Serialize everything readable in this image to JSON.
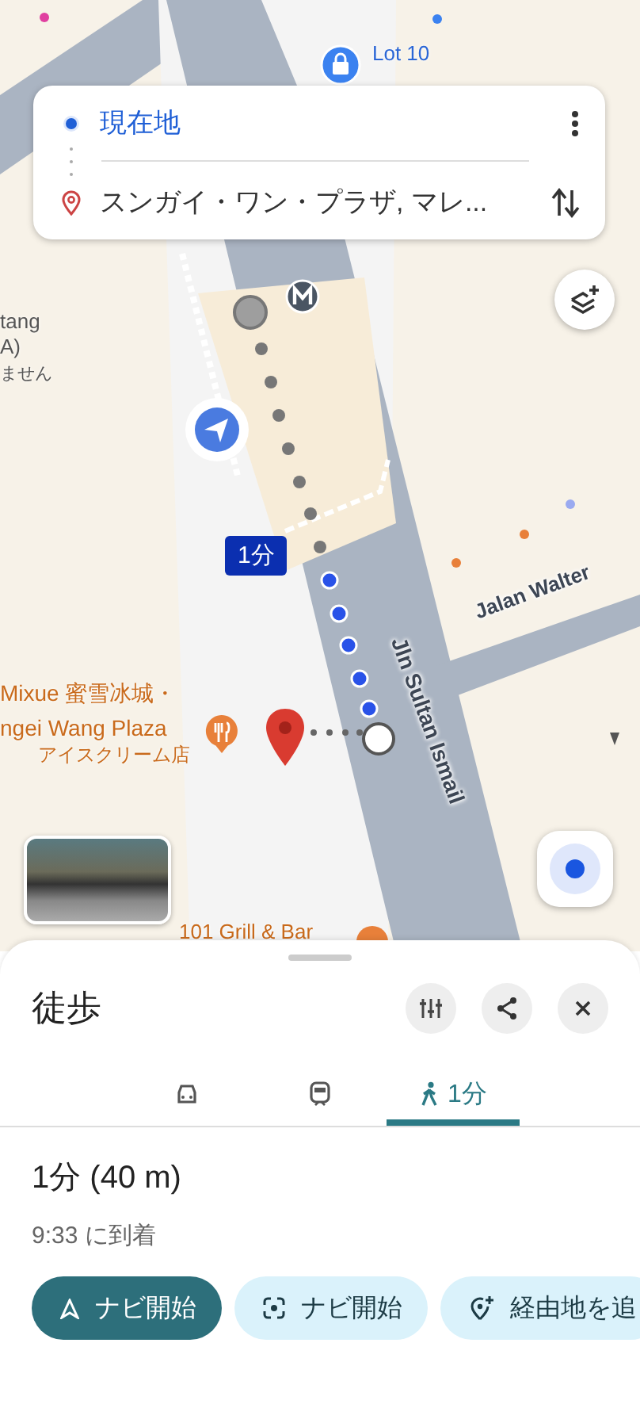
{
  "directions_card": {
    "origin": "現在地",
    "destination": "スンガイ・ワン・プラザ, マレ..."
  },
  "map": {
    "route_badge": "1分",
    "labels": [
      {
        "kind": "poi",
        "text": "Lot 10"
      },
      {
        "kind": "place",
        "text": "tang"
      },
      {
        "kind": "place",
        "text": "A)"
      },
      {
        "kind": "place",
        "text": "ません"
      },
      {
        "kind": "road",
        "text": "Jalan Walter"
      },
      {
        "kind": "road",
        "text": "Jln Sultan Ismail"
      },
      {
        "kind": "food",
        "text": "Mixue 蜜雪冰城・"
      },
      {
        "kind": "food",
        "text": "ngei Wang Plaza"
      },
      {
        "kind": "food-sub",
        "text": "アイスクリーム店"
      },
      {
        "kind": "food",
        "text": "101 Grill & Bar"
      }
    ]
  },
  "sheet": {
    "title": "徒歩",
    "modes": [
      {
        "kind": "car",
        "selected": false
      },
      {
        "kind": "transit",
        "selected": false
      },
      {
        "kind": "walk",
        "label": "1分",
        "selected": true
      }
    ],
    "summary": "1分 (40 m)",
    "arrival": "9:33 に到着",
    "actions": [
      {
        "kind": "navigate",
        "label": "ナビ開始",
        "filled": true
      },
      {
        "kind": "live-view",
        "label": "ナビ開始",
        "filled": false
      },
      {
        "kind": "add-stop",
        "label": "経由地を追",
        "filled": false
      }
    ]
  }
}
